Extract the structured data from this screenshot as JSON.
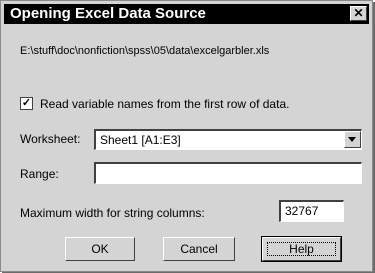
{
  "window": {
    "title": "Opening Excel Data Source",
    "close_glyph": "✕"
  },
  "source_path": "E:\\stuff\\doc\\nonfiction\\spss\\05\\data\\excelgarbler.xls",
  "options": {
    "read_names_label": "Read variable names from the first row of data.",
    "read_names_checked": true,
    "check_glyph": "✓"
  },
  "worksheet": {
    "label": "Worksheet:",
    "value": "Sheet1  [A1:E3]"
  },
  "range": {
    "label": "Range:",
    "value": ""
  },
  "max_width": {
    "label": "Maximum width for string columns:",
    "value": "32767"
  },
  "buttons": {
    "ok": "OK",
    "cancel": "Cancel",
    "help": "Help"
  }
}
